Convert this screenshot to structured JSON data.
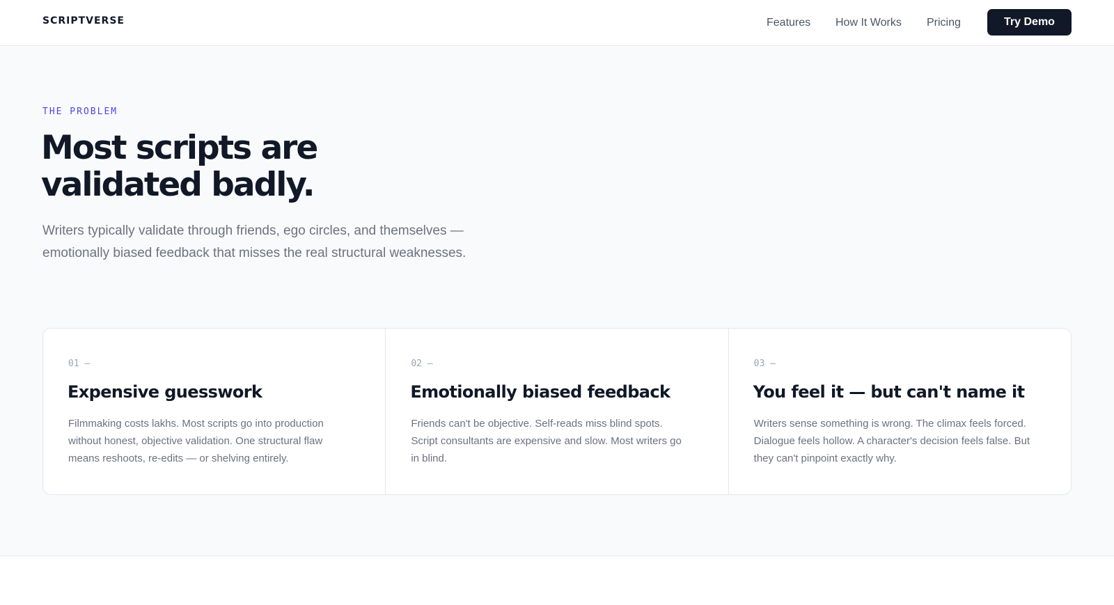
{
  "header": {
    "brand": "SCRIPTVERSE",
    "nav": [
      "Features",
      "How It Works",
      "Pricing"
    ],
    "cta": "Try Demo"
  },
  "problem": {
    "eyebrow": "THE PROBLEM",
    "title_line1": "Most scripts are",
    "title_line2": "validated badly.",
    "lede": "Writers typically validate through friends, ego circles, and themselves — emotionally biased feedback that misses the real structural weaknesses.",
    "cards": [
      {
        "num": "01 —",
        "title": "Expensive guesswork",
        "body": "Filmmaking costs lakhs. Most scripts go into production without honest, objective validation. One structural flaw means reshoots, re-edits — or shelving entirely."
      },
      {
        "num": "02 —",
        "title": "Emotionally biased feedback",
        "body": "Friends can't be objective. Self-reads miss blind spots. Script consultants are expensive and slow. Most writers go in blind."
      },
      {
        "num": "03 —",
        "title": "You feel it — but can't name it",
        "body": "Writers sense something is wrong. The climax feels forced. Dialogue feels hollow. A character's decision feels false. But they can't pinpoint exactly why."
      }
    ]
  },
  "colors": {
    "accent": "#4f46e5",
    "ink": "#111827",
    "muted": "#6b7280",
    "section_bg": "#f9fafb",
    "border": "#e5e7eb"
  }
}
